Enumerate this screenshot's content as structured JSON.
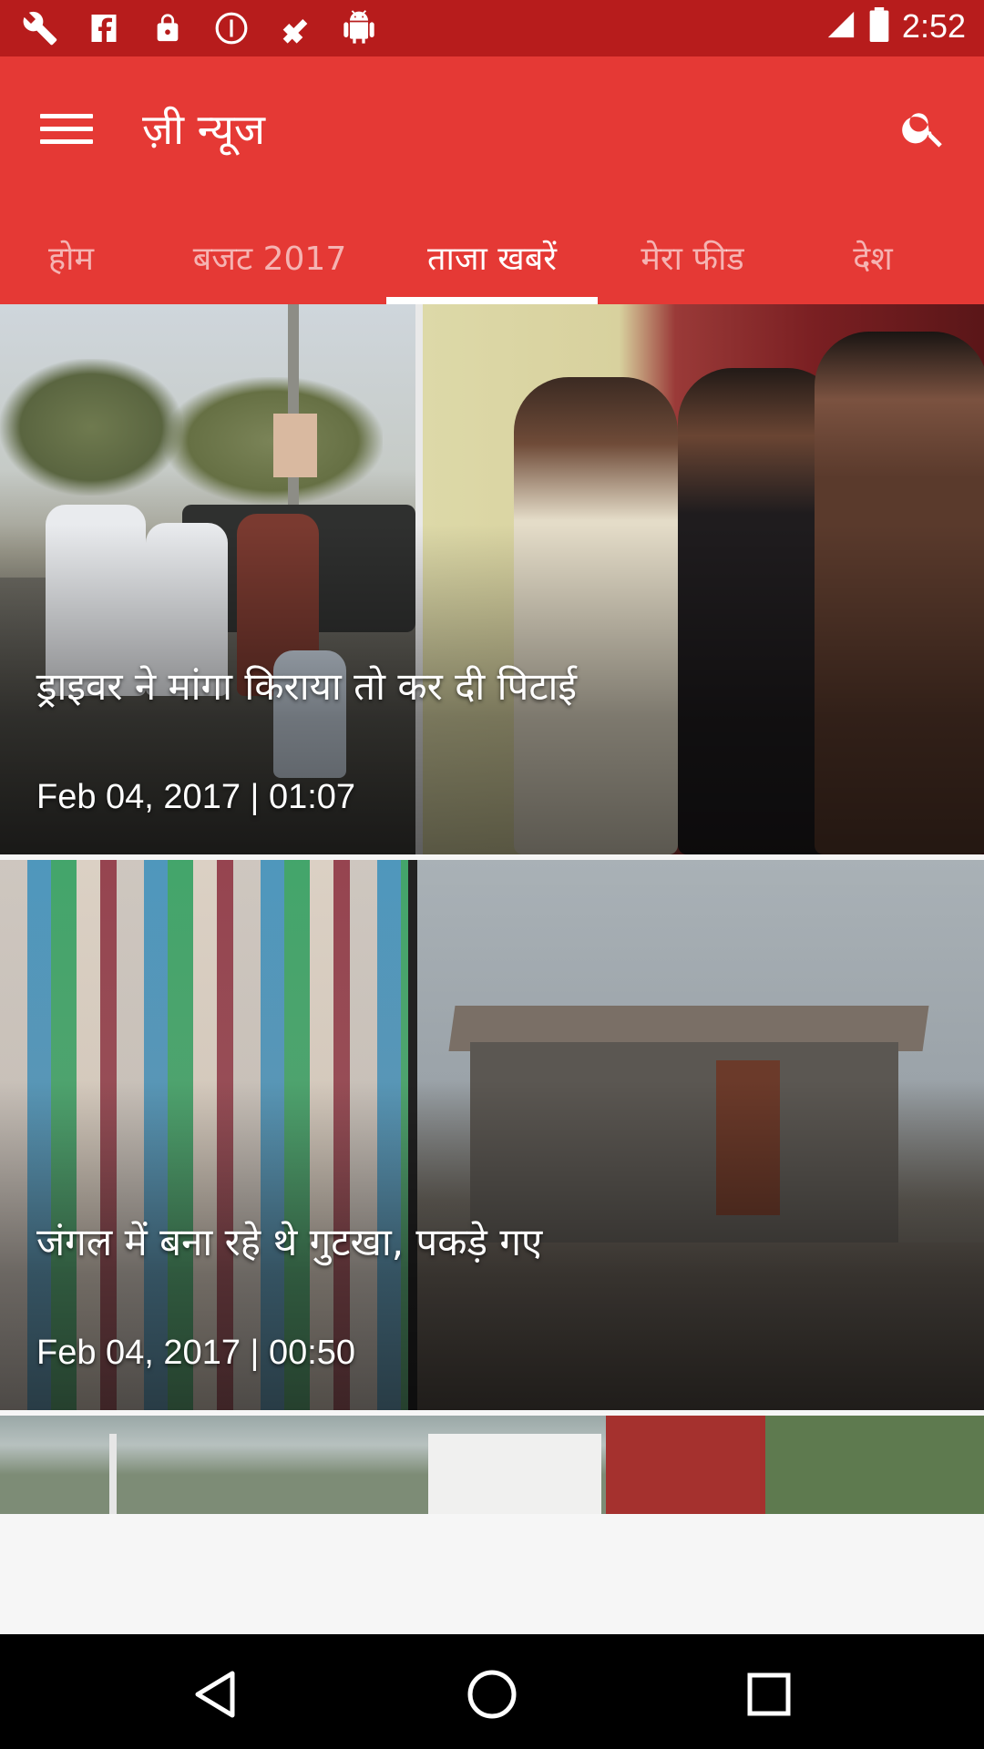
{
  "status_bar": {
    "time": "2:52",
    "icons": [
      "wrench-icon",
      "facebook-icon",
      "lock-icon",
      "do-not-disturb-icon",
      "fake-gps-icon",
      "android-icon"
    ]
  },
  "app_bar": {
    "title": "ज़ी न्यूज",
    "menu_icon": "menu-icon",
    "search_icon": "search-icon"
  },
  "tabs": [
    {
      "label": "होम",
      "active": false
    },
    {
      "label": "बजट 2017",
      "active": false
    },
    {
      "label": "ताजा खबरें",
      "active": true
    },
    {
      "label": "मेरा फीड",
      "active": false
    },
    {
      "label": "देश",
      "active": false
    }
  ],
  "feed": {
    "items": [
      {
        "headline": "ड्राइवर ने मांगा किराया तो कर दी पिटाई",
        "meta": "Feb 04, 2017 | 01:07"
      },
      {
        "headline": "जंगल में बना रहे थे गुटखा, पकड़े गए",
        "meta": "Feb 04, 2017 | 00:50"
      }
    ]
  },
  "colors": {
    "status_bar": "#b71c1c",
    "app_bar": "#e53935",
    "nav_bar": "#000000"
  },
  "nav": {
    "back_icon": "back-triangle-icon",
    "home_icon": "home-circle-icon",
    "recents_icon": "recents-square-icon"
  }
}
